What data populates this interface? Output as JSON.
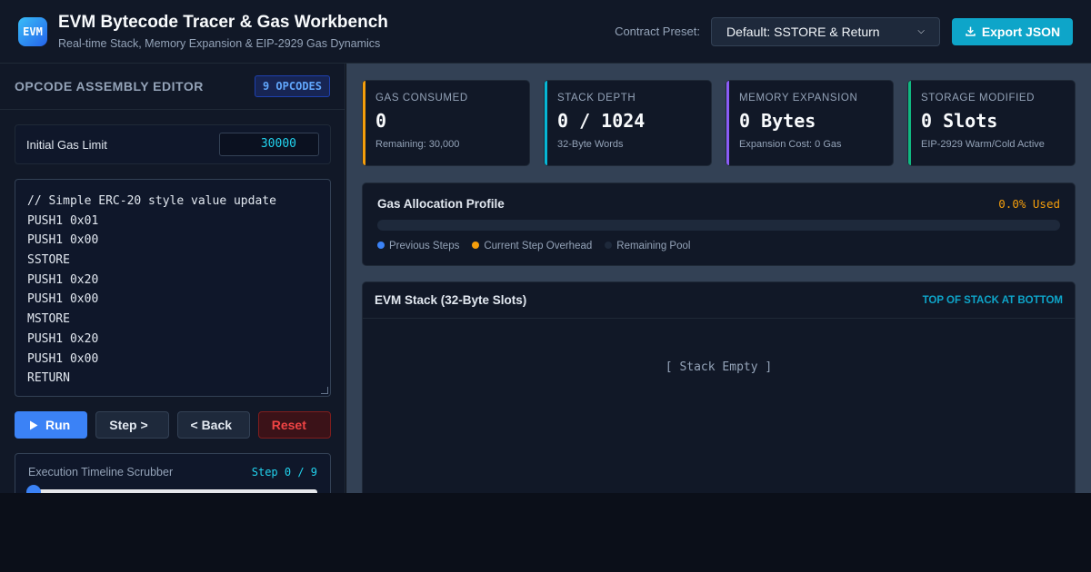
{
  "header": {
    "logo_text": "EVM",
    "title": "EVM Bytecode Tracer & Gas Workbench",
    "subtitle": "Real-time Stack, Memory Expansion & EIP-2929 Gas Dynamics",
    "preset_label": "Contract Preset:",
    "preset_value": "Default: SSTORE & Return",
    "export_label": "Export JSON"
  },
  "editor_panel": {
    "title": "OPCODE ASSEMBLY EDITOR",
    "opcode_badge": "9 OPCODES",
    "gas_limit_label": "Initial Gas Limit",
    "gas_limit_value": "30000",
    "code_lines": [
      "// Simple ERC-20 style value update",
      "PUSH1 0x01",
      "PUSH1 0x00",
      "SSTORE",
      "PUSH1 0x20",
      "PUSH1 0x00",
      "MSTORE",
      "PUSH1 0x20",
      "PUSH1 0x00",
      "RETURN"
    ],
    "buttons": {
      "run": "Run",
      "step": "Step >",
      "back": "< Back",
      "reset": "Reset"
    },
    "scrubber": {
      "label": "Execution Timeline Scrubber",
      "step_text": "Step 0 / 9",
      "position": 0
    }
  },
  "stats": [
    {
      "title": "GAS CONSUMED",
      "value": "0",
      "sub": "Remaining: 30,000",
      "color": "#f59e0b"
    },
    {
      "title": "STACK DEPTH",
      "value": "0 / 1024",
      "sub": "32-Byte Words",
      "color": "#06b6d4"
    },
    {
      "title": "MEMORY EXPANSION",
      "value": "0 Bytes",
      "sub": "Expansion Cost: 0 Gas",
      "color": "#8b5cf6"
    },
    {
      "title": "STORAGE MODIFIED",
      "value": "0 Slots",
      "sub": "EIP-2929 Warm/Cold Active",
      "color": "#10b981"
    }
  ],
  "gas_profile": {
    "title": "Gas Allocation Profile",
    "used_text": "0.0% Used",
    "used_fraction": 0.0,
    "legend": [
      {
        "label": "Previous Steps",
        "color": "#3b82f6"
      },
      {
        "label": "Current Step Overhead",
        "color": "#f59e0b"
      },
      {
        "label": "Remaining Pool",
        "color": "#1e293b"
      }
    ]
  },
  "stack": {
    "title": "EVM Stack (32-Byte Slots)",
    "note": "TOP OF STACK AT BOTTOM",
    "empty_text": "[ Stack Empty ]"
  }
}
